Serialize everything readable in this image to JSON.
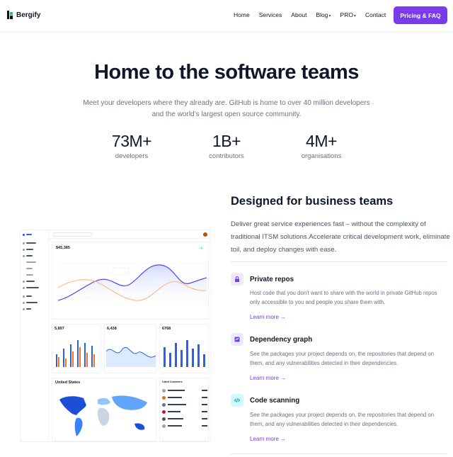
{
  "nav": {
    "brand": "Bergify",
    "links": [
      "Home",
      "Services",
      "About",
      "Blog",
      "PRO",
      "Contact"
    ],
    "dropdown_links": [
      "Blog",
      "PRO"
    ],
    "cta": "Pricing & FAQ",
    "accent": "#7c3aed"
  },
  "hero": {
    "title": "Home to the software teams",
    "subtitle_line1": "Meet your developers where they already are. GitHub is home to over 40 million developers",
    "subtitle_line2": "and the world’s largest open source community.",
    "stats": [
      {
        "value": "73M+",
        "label": "developers"
      },
      {
        "value": "1B+",
        "label": "contributors"
      },
      {
        "value": "4M+",
        "label": "organisations"
      }
    ]
  },
  "mockup": {
    "top_value": "$45,385",
    "small_values": [
      "5,897",
      "6,438",
      "6768"
    ],
    "map_title": "United States",
    "table_title": "Latest Customers"
  },
  "features": {
    "title": "Designed for business teams",
    "description": "Deliver great service experiences fast – without the complexity of traditional ITSM solutions.Accelerate critical development work, eliminate toil, and deploy changes with ease.",
    "items": [
      {
        "icon": "lock-icon",
        "title": "Private repos",
        "desc": "Host code that you don't want to share with the world in private GitHub repos only accessible to you and people you share them with.",
        "link": "Learn more →"
      },
      {
        "icon": "dependency-graph-icon",
        "title": "Dependency graph",
        "desc": "See the packages your project depends on, the repositories that depend on them, and any vulnerabilities detected in their dependencies.",
        "link": "Learn more →"
      },
      {
        "icon": "code-icon",
        "title": "Code scanning",
        "desc": "See the packages your project depends on, the repositories that depend on them, and any vulnerabilities detected in their dependencies.",
        "link": "Learn more →"
      }
    ]
  }
}
